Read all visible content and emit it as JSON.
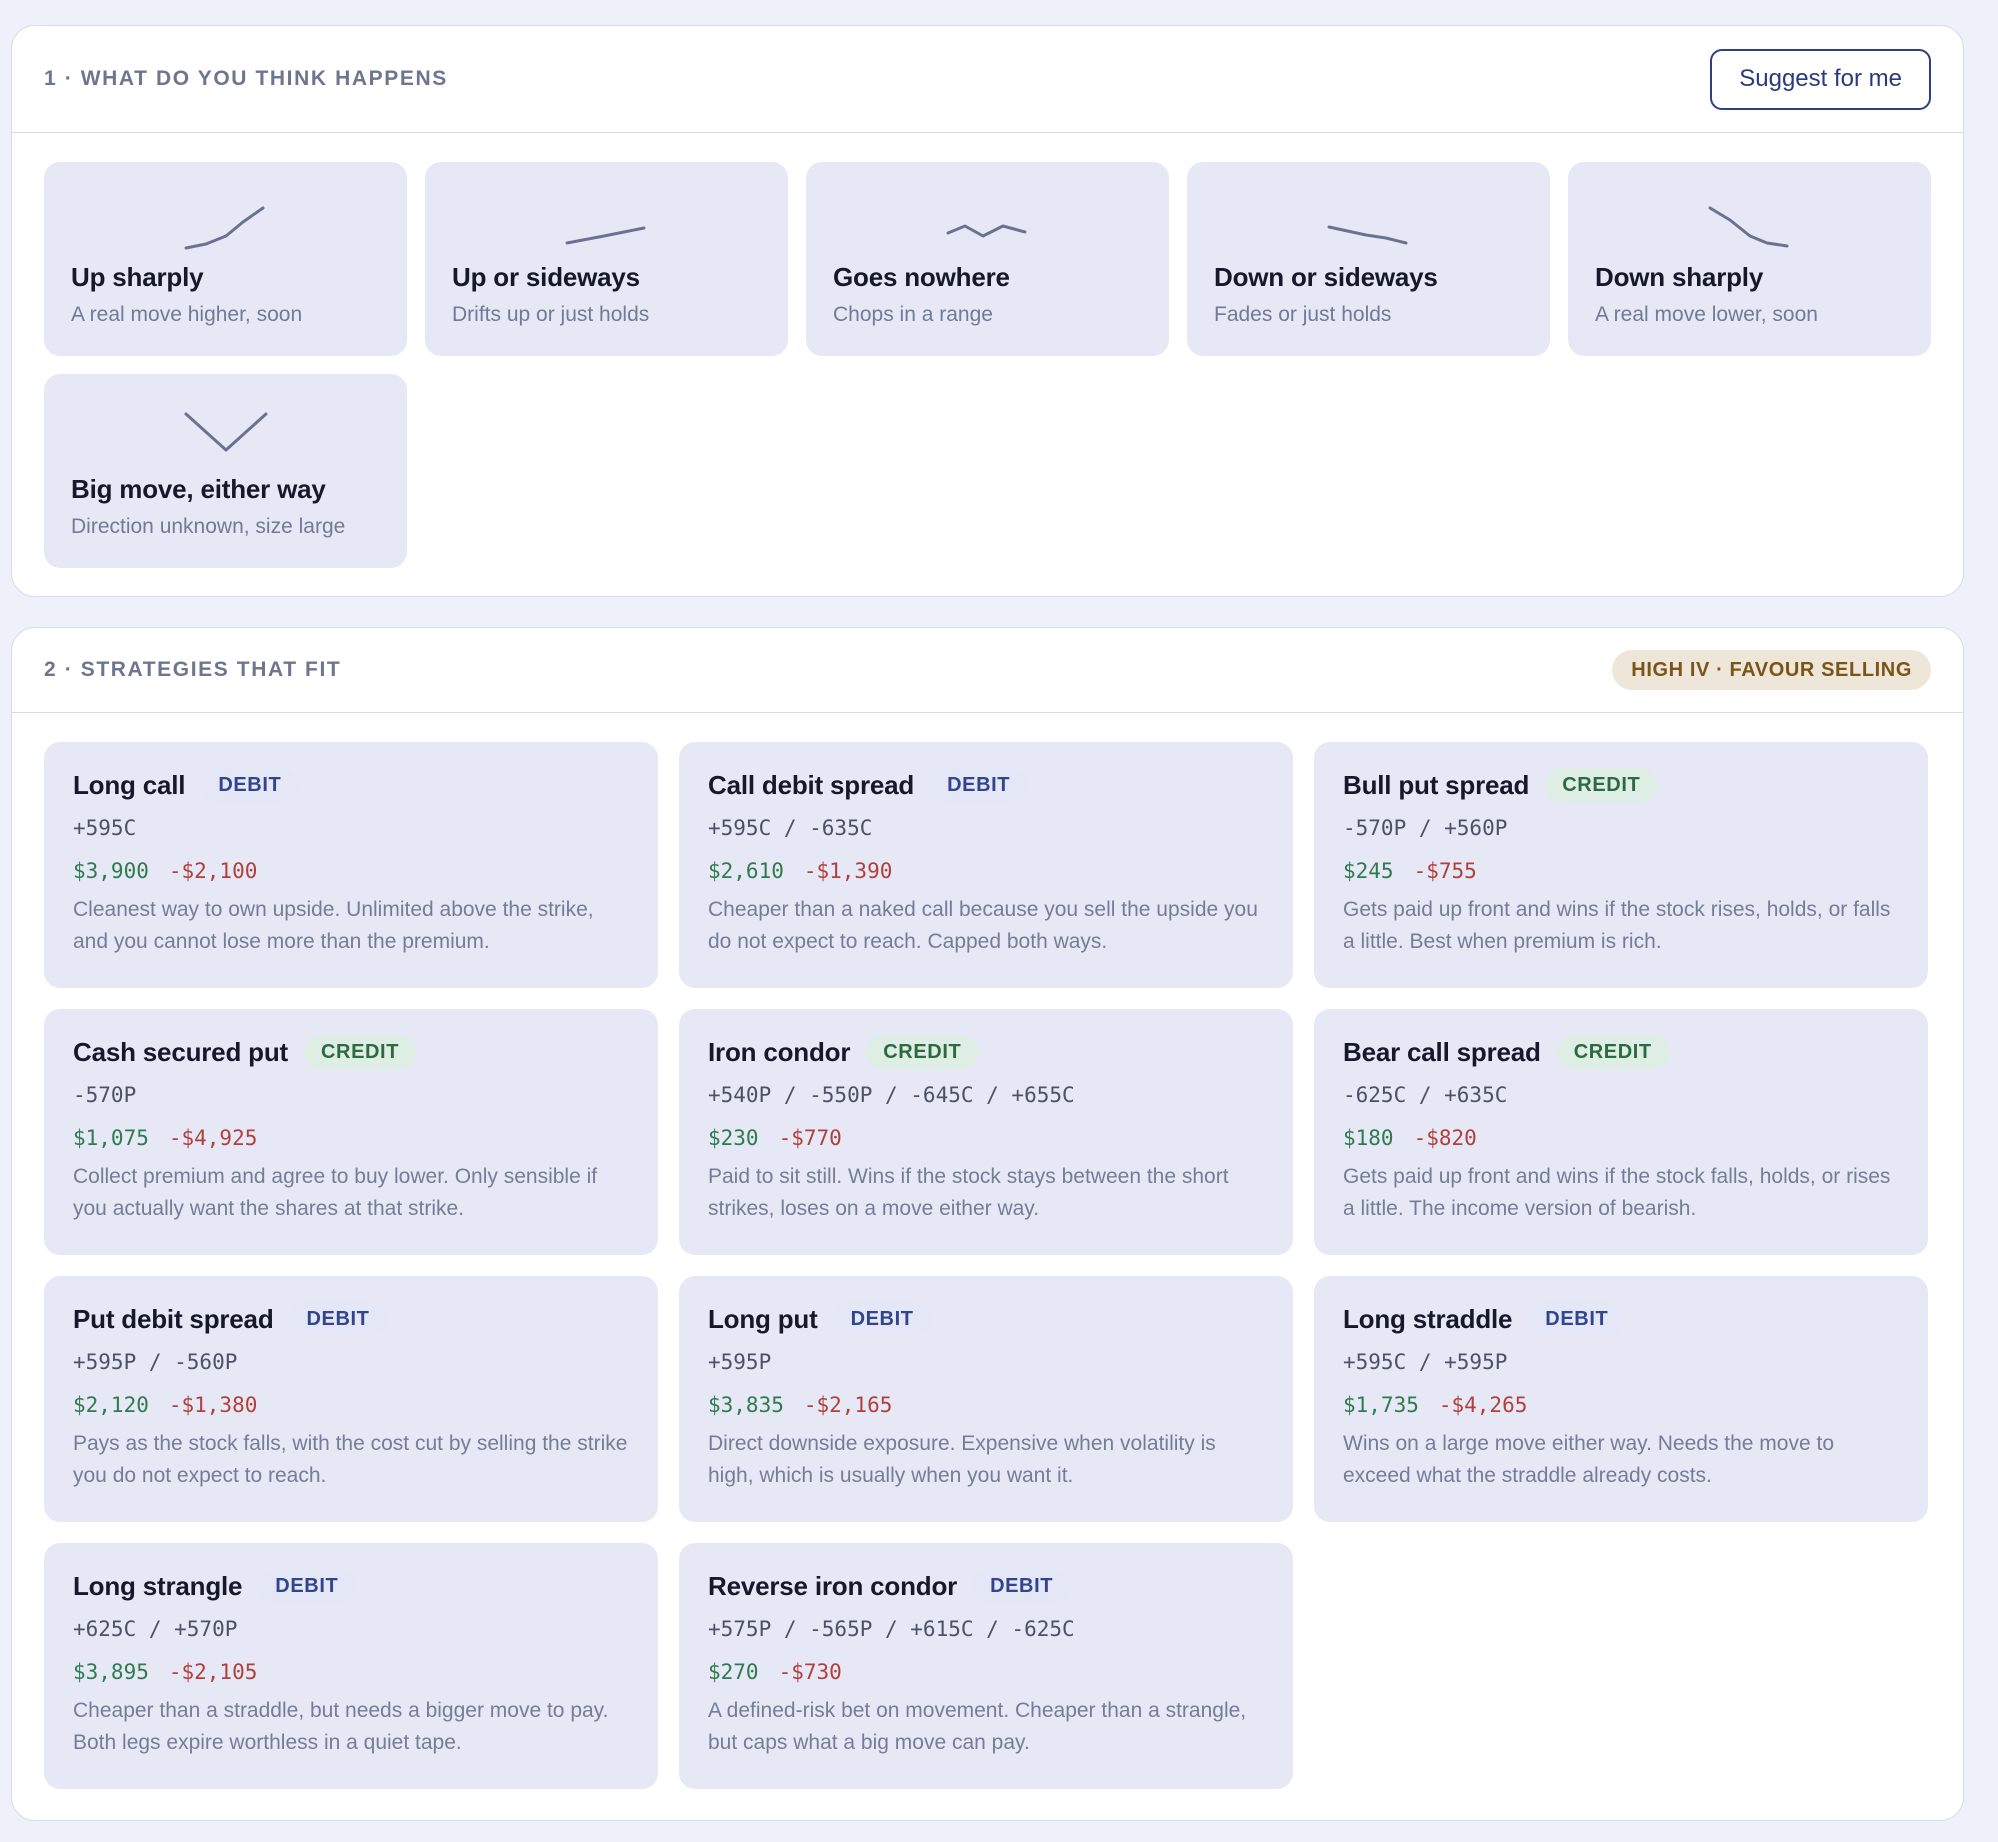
{
  "outlook": {
    "title": "1 · What do you think happens",
    "suggest_label": "Suggest for me",
    "scenarios": [
      {
        "title": "Up sharply",
        "subtitle": "A real move higher, soon",
        "icon": "up-sharply-sparkline-icon",
        "shape": "up-sharply"
      },
      {
        "title": "Up or sideways",
        "subtitle": "Drifts up or just holds",
        "icon": "up-sideways-sparkline-icon",
        "shape": "up-sideways"
      },
      {
        "title": "Goes nowhere",
        "subtitle": "Chops in a range",
        "icon": "flat-sparkline-icon",
        "shape": "flat"
      },
      {
        "title": "Down or sideways",
        "subtitle": "Fades or just holds",
        "icon": "down-sideways-sparkline-icon",
        "shape": "down-sideways"
      },
      {
        "title": "Down sharply",
        "subtitle": "A real move lower, soon",
        "icon": "down-sharply-sparkline-icon",
        "shape": "down-sharply"
      },
      {
        "title": "Big move, either way",
        "subtitle": "Direction unknown, size large",
        "icon": "v-shape-sparkline-icon",
        "shape": "v-shape"
      }
    ]
  },
  "strategies": {
    "title": "2 · Strategies that fit",
    "badge": "HIGH IV · FAVOUR SELLING",
    "colors": {
      "gain": "#2f7a4f",
      "loss": "#b13f3b",
      "debit": "#33448e",
      "credit": "#2c6a44",
      "badge": "#7a5418"
    },
    "items": [
      {
        "name": "Long call",
        "type": "DEBIT",
        "legs": "+595C",
        "max_gain": "$3,900",
        "max_loss": "-$2,100",
        "description": "Cleanest way to own upside. Unlimited above the strike, and you cannot lose more than the premium."
      },
      {
        "name": "Call debit spread",
        "type": "DEBIT",
        "legs": "+595C / -635C",
        "max_gain": "$2,610",
        "max_loss": "-$1,390",
        "description": "Cheaper than a naked call because you sell the upside you do not expect to reach. Capped both ways."
      },
      {
        "name": "Bull put spread",
        "type": "CREDIT",
        "legs": "-570P / +560P",
        "max_gain": "$245",
        "max_loss": "-$755",
        "description": "Gets paid up front and wins if the stock rises, holds, or falls a little. Best when premium is rich."
      },
      {
        "name": "Cash secured put",
        "type": "CREDIT",
        "legs": "-570P",
        "max_gain": "$1,075",
        "max_loss": "-$4,925",
        "description": "Collect premium and agree to buy lower. Only sensible if you actually want the shares at that strike."
      },
      {
        "name": "Iron condor",
        "type": "CREDIT",
        "legs": "+540P / -550P / -645C / +655C",
        "max_gain": "$230",
        "max_loss": "-$770",
        "description": "Paid to sit still. Wins if the stock stays between the short strikes, loses on a move either way."
      },
      {
        "name": "Bear call spread",
        "type": "CREDIT",
        "legs": "-625C / +635C",
        "max_gain": "$180",
        "max_loss": "-$820",
        "description": "Gets paid up front and wins if the stock falls, holds, or rises a little. The income version of bearish."
      },
      {
        "name": "Put debit spread",
        "type": "DEBIT",
        "legs": "+595P / -560P",
        "max_gain": "$2,120",
        "max_loss": "-$1,380",
        "description": "Pays as the stock falls, with the cost cut by selling the strike you do not expect to reach."
      },
      {
        "name": "Long put",
        "type": "DEBIT",
        "legs": "+595P",
        "max_gain": "$3,835",
        "max_loss": "-$2,165",
        "description": "Direct downside exposure. Expensive when volatility is high, which is usually when you want it."
      },
      {
        "name": "Long straddle",
        "type": "DEBIT",
        "legs": "+595C / +595P",
        "max_gain": "$1,735",
        "max_loss": "-$4,265",
        "description": "Wins on a large move either way. Needs the move to exceed what the straddle already costs."
      },
      {
        "name": "Long strangle",
        "type": "DEBIT",
        "legs": "+625C / +570P",
        "max_gain": "$3,895",
        "max_loss": "-$2,105",
        "description": "Cheaper than a straddle, but needs a bigger move to pay. Both legs expire worthless in a quiet tape."
      },
      {
        "name": "Reverse iron condor",
        "type": "DEBIT",
        "legs": "+575P / -565P / +615C / -625C",
        "max_gain": "$270",
        "max_loss": "-$730",
        "description": "A defined-risk bet on movement. Cheaper than a strangle, but caps what a big move can pay."
      }
    ]
  }
}
